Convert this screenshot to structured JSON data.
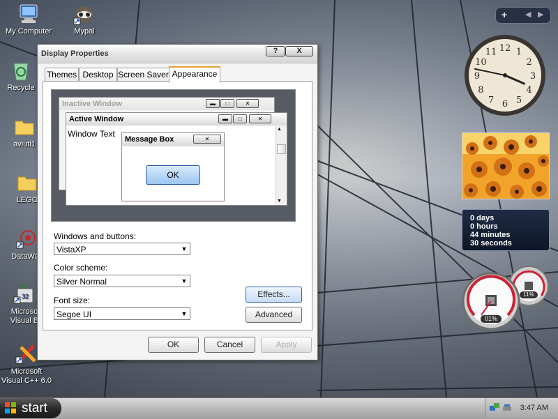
{
  "desktop": {
    "icons": [
      {
        "label": "My Computer"
      },
      {
        "label": "Mypal"
      },
      {
        "label": "Recycle"
      },
      {
        "label": "aviuti1"
      },
      {
        "label": "LEGO"
      },
      {
        "label": "DataWag"
      },
      {
        "label": "Microso",
        "label2": "Visual B"
      },
      {
        "label": "Microsoft",
        "label2": "Visual C++ 6.0"
      }
    ]
  },
  "dialog": {
    "title": "Display Properties",
    "help_label": "?",
    "close_label": "X",
    "tabs": [
      {
        "label": "Themes",
        "active": false
      },
      {
        "label": "Desktop",
        "active": false
      },
      {
        "label": "Screen Saver",
        "active": false
      },
      {
        "label": "Appearance",
        "active": true
      }
    ],
    "preview": {
      "inactive_title": "Inactive Window",
      "active_title": "Active Window",
      "window_text": "Window Text",
      "msgbox_title": "Message Box",
      "ok_label": "OK"
    },
    "windows_buttons": {
      "label": "Windows and buttons:",
      "value": "VistaXP"
    },
    "color_scheme": {
      "label": "Color scheme:",
      "value": "Silver Normal"
    },
    "font_size": {
      "label": "Font size:",
      "value": "Segoe UI"
    },
    "effects_label": "Effects...",
    "advanced_label": "Advanced",
    "ok_label": "OK",
    "cancel_label": "Cancel",
    "apply_label": "Apply"
  },
  "gadgets": {
    "clock": {
      "hour": 3,
      "minute": 47,
      "numerals": [
        "12",
        "1",
        "2",
        "3",
        "4",
        "5",
        "6",
        "7",
        "8",
        "9",
        "10",
        "11"
      ]
    },
    "countdown": {
      "line1": "0 days",
      "line2": "0 hours",
      "line3": "44 minutes",
      "line4": "30 seconds"
    },
    "cpu_percent": "01%",
    "mem_percent": "11%"
  },
  "taskbar": {
    "start_label": "start",
    "clock": "3:47 AM"
  },
  "colors": {
    "tab_accent": "#e8a33b",
    "taskbar": "#bdbdbd",
    "start_button": "#2a2a2a"
  }
}
